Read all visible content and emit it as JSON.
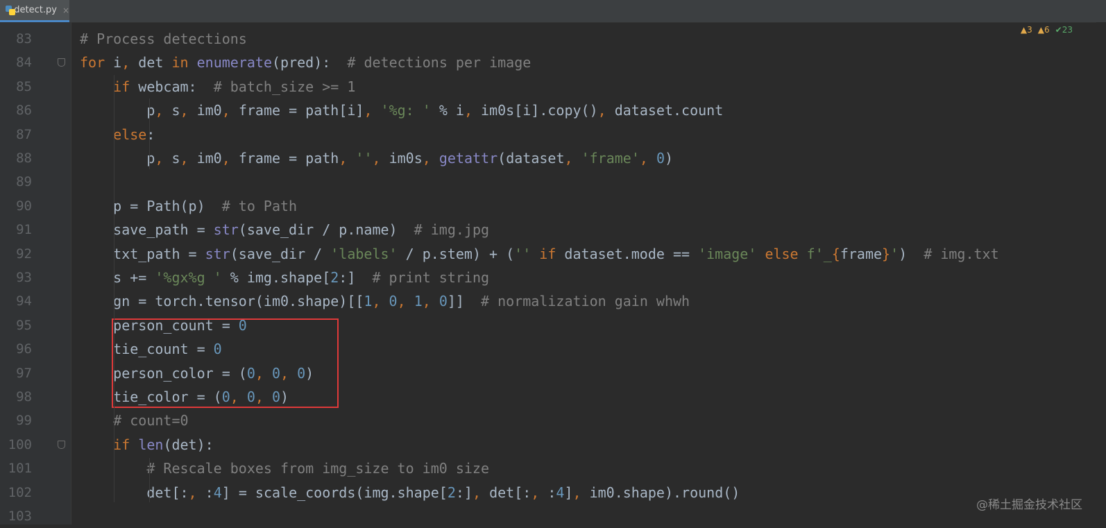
{
  "tab": {
    "filename": "detect.py",
    "close": "×"
  },
  "status": {
    "warnings": "▲3",
    "weak_warnings": "▲6",
    "ok": "✔23"
  },
  "lines": [
    {
      "n": "83",
      "code": "<span class='cm'># Process detections</span>"
    },
    {
      "n": "84",
      "code": "<span class='kw'>for</span> i<span class='pc'>,</span> det <span class='kw'>in</span> <span class='bi'>enumerate</span>(pred):  <span class='cm'># detections per image</span>"
    },
    {
      "n": "85",
      "code": "    <span class='kw'>if</span> webcam:  <span class='cm'># batch_size >= 1</span>"
    },
    {
      "n": "86",
      "code": "        p<span class='pc'>,</span> s<span class='pc'>,</span> im0<span class='pc'>,</span> frame = path[i]<span class='pc'>,</span> <span class='st'>'%g: '</span> % i<span class='pc'>,</span> im0s[i].copy()<span class='pc'>,</span> dataset.count"
    },
    {
      "n": "87",
      "code": "    <span class='kw'>else</span>:"
    },
    {
      "n": "88",
      "code": "        p<span class='pc'>,</span> s<span class='pc'>,</span> im0<span class='pc'>,</span> frame = path<span class='pc'>,</span> <span class='st'>''</span><span class='pc'>,</span> im0s<span class='pc'>,</span> <span class='bi'>getattr</span>(dataset<span class='pc'>,</span> <span class='st'>'frame'</span><span class='pc'>,</span> <span class='nu'>0</span>)"
    },
    {
      "n": "89",
      "code": ""
    },
    {
      "n": "90",
      "code": "    p = Path(p)  <span class='cm'># to Path</span>"
    },
    {
      "n": "91",
      "code": "    save_path = <span class='bi'>str</span>(save_dir / p.name)  <span class='cm'># img.jpg</span>"
    },
    {
      "n": "92",
      "code": "    txt_path = <span class='bi'>str</span>(save_dir / <span class='st'>'labels'</span> / p.stem) + (<span class='st'>''</span> <span class='kw'>if</span> dataset.mode == <span class='st'>'image'</span> <span class='kw'>else</span> <span class='st'>f'_</span><span class='pc'>{</span>frame<span class='pc'>}</span><span class='st'>'</span>)  <span class='cm'># img.txt</span>"
    },
    {
      "n": "93",
      "code": "    s += <span class='st'>'%gx%g '</span> % img.shape[<span class='nu'>2</span>:]  <span class='cm'># print string</span>"
    },
    {
      "n": "94",
      "code": "    gn = torch.tensor(im0.shape)[[<span class='nu'>1</span><span class='pc'>,</span> <span class='nu'>0</span><span class='pc'>,</span> <span class='nu'>1</span><span class='pc'>,</span> <span class='nu'>0</span>]]  <span class='cm'># normalization gain whwh</span>"
    },
    {
      "n": "95",
      "code": "    person_count = <span class='nu'>0</span>"
    },
    {
      "n": "96",
      "code": "    tie_count = <span class='nu'>0</span>"
    },
    {
      "n": "97",
      "code": "    person_color = (<span class='nu'>0</span><span class='pc'>,</span> <span class='nu'>0</span><span class='pc'>,</span> <span class='nu'>0</span>)"
    },
    {
      "n": "98",
      "code": "    tie_color = (<span class='nu'>0</span><span class='pc'>,</span> <span class='nu'>0</span><span class='pc'>,</span> <span class='nu'>0</span>)"
    },
    {
      "n": "99",
      "code": "    <span class='cm'># count=0</span>"
    },
    {
      "n": "100",
      "code": "    <span class='kw'>if</span> <span class='bi'>len</span>(det):"
    },
    {
      "n": "101",
      "code": "        <span class='cm'># Rescale boxes from img_size to im0 size</span>"
    },
    {
      "n": "102",
      "code": "        det[:<span class='pc'>,</span> :<span class='nu'>4</span>] = scale_coords(img.shape[<span class='nu'>2</span>:]<span class='pc'>,</span> det[:<span class='pc'>,</span> :<span class='nu'>4</span>]<span class='pc'>,</span> im0.shape).round()"
    },
    {
      "n": "103",
      "code": ""
    }
  ],
  "watermark": "@稀土掘金技术社区"
}
